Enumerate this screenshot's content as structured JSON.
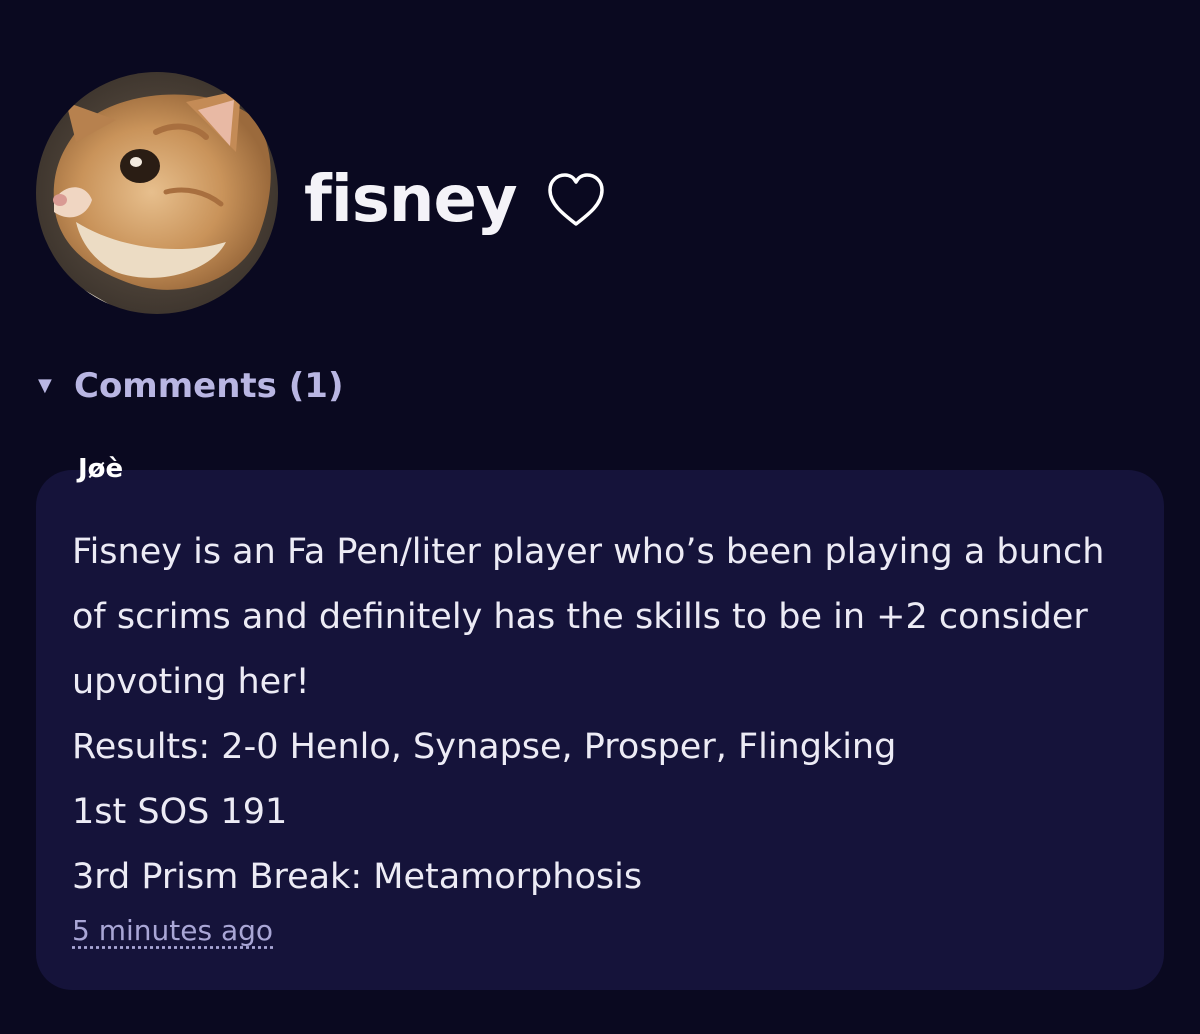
{
  "profile": {
    "username": "fisney",
    "heart_icon": "heart-outline-icon",
    "avatar": {
      "description_icon": "cat-avatar",
      "colors": {
        "fur": "#c9935a",
        "fur_light": "#e3c6a3",
        "background": "#4a4238"
      }
    }
  },
  "comments": {
    "toggle_icon": "triangle-down-icon",
    "toggle_glyph": "▼",
    "label": "Comments (1)",
    "items": [
      {
        "author": "Jøè",
        "body": "Fisney is an Fa Pen/liter player who’s been playing a bunch of scrims and definitely has the skills to be in +2 consider upvoting her!\nResults: 2-0 Henlo, Synapse, Prosper, Flingking\n1st SOS 191\n3rd Prism Break: Metamorphosis",
        "timestamp": "5 minutes ago"
      }
    ]
  },
  "colors": {
    "background": "#0a0920",
    "card": "#15133a",
    "accent_text": "#b9b6e3",
    "body_text": "#ecebf5"
  }
}
